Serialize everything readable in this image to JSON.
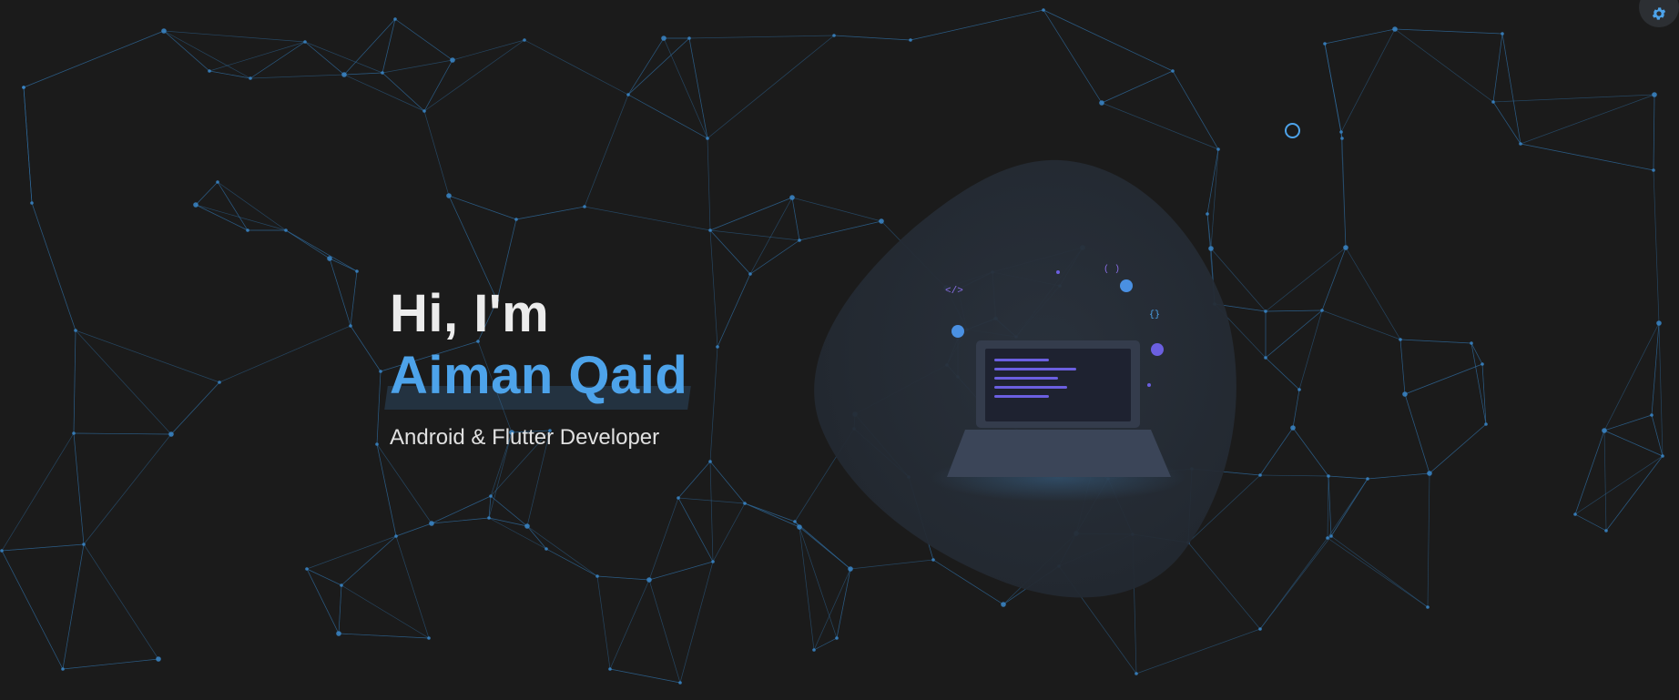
{
  "hero": {
    "greeting": "Hi, I'm",
    "name": "Aiman Qaid",
    "role": "Android & Flutter Developer"
  },
  "illustration": {
    "code_tag_left": "</>",
    "code_tag_parens": "( )",
    "code_tag_braces": "{}"
  },
  "icons": {
    "settings": "gear-icon",
    "cursor": "cursor-ring-icon"
  },
  "colors": {
    "background": "#1b1b1b",
    "accent": "#4da3ea",
    "network_line": "#2f6a9a",
    "network_node": "#3a86c8",
    "blob": "#262d36",
    "laptop_body": "#3b4558",
    "code_line": "#6b5fe0"
  }
}
